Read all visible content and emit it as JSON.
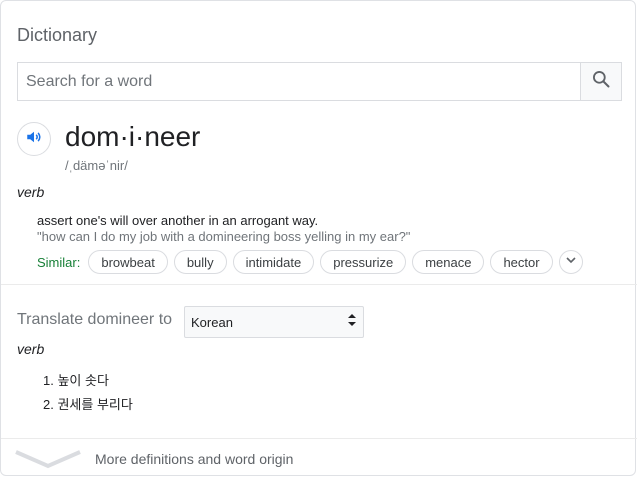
{
  "header": {
    "title": "Dictionary"
  },
  "search": {
    "placeholder": "Search for a word"
  },
  "entry": {
    "word": "dom·i·neer",
    "phonetic": "/ˌdäməˈnir/",
    "part_of_speech": "verb",
    "definition": "assert one's will over another in an arrogant way.",
    "example": "\"how can I do my job with a domineering boss yelling in my ear?\"",
    "similar_label": "Similar:",
    "similar": [
      "browbeat",
      "bully",
      "intimidate",
      "pressurize",
      "menace",
      "hector"
    ]
  },
  "translate": {
    "label": "Translate domineer to",
    "language": "Korean",
    "part_of_speech": "verb",
    "items": [
      "1. 높이 솟다",
      "2. 권세를 부리다"
    ]
  },
  "footer": {
    "more_label": "More definitions and word origin"
  },
  "colors": {
    "accent": "#1a73e8",
    "similar_green": "#188038",
    "muted": "#70757a"
  },
  "icons": [
    "search-icon",
    "speaker-icon",
    "chevron-down-icon",
    "select-arrows-icon",
    "expand-chevron-icon"
  ]
}
